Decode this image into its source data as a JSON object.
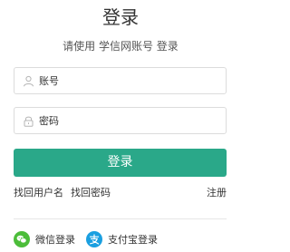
{
  "header": {
    "title": "登录",
    "subtitle": "请使用 学信网账号 登录"
  },
  "form": {
    "username_placeholder": "账号",
    "password_placeholder": "密码",
    "submit_label": "登录"
  },
  "links": {
    "recover_username": "找回用户名",
    "recover_password": "找回密码",
    "register": "注册"
  },
  "social": {
    "wechat_label": "微信登录",
    "alipay_label": "支付宝登录"
  },
  "colors": {
    "primary": "#2aa889",
    "wechat": "#4cbd3a",
    "alipay": "#1a9fe0",
    "border": "#dcdcdc"
  },
  "icons": {
    "username": "user-icon",
    "password": "lock-icon",
    "wechat": "wechat-icon",
    "alipay": "alipay-icon"
  }
}
